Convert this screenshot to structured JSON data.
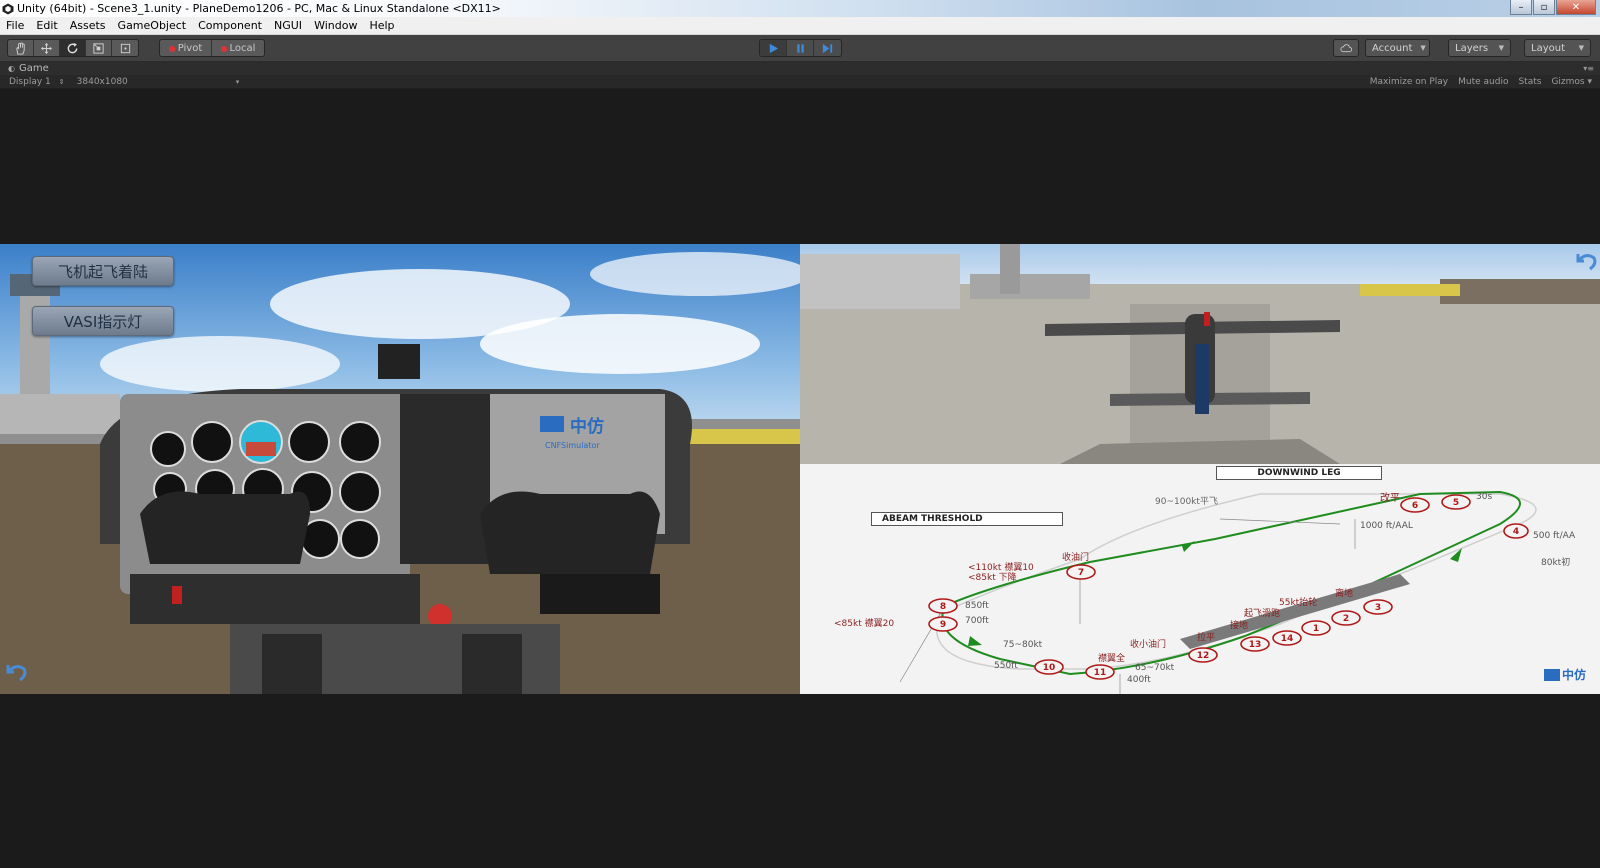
{
  "window": {
    "title": "Unity (64bit) - Scene3_1.unity - PlaneDemo1206 - PC, Mac & Linux Standalone <DX11>",
    "controls": [
      "minimize-icon",
      "maximize-icon",
      "close-icon"
    ]
  },
  "menu": {
    "items": [
      "File",
      "Edit",
      "Assets",
      "GameObject",
      "Component",
      "NGUI",
      "Window",
      "Help"
    ]
  },
  "toolbar": {
    "tools": [
      "hand-icon",
      "move-icon",
      "rotate-icon",
      "scale-icon",
      "rect-icon"
    ],
    "pivot_label": "Pivot",
    "local_label": "Local",
    "play": [
      "play-icon",
      "pause-icon",
      "step-icon"
    ],
    "account_label": "Account",
    "layers_label": "Layers",
    "layout_label": "Layout"
  },
  "game_tab": {
    "label": "Game",
    "display": "Display 1",
    "resolution": "3840x1080",
    "maximize_on_play": "Maximize on Play",
    "mute_audio": "Mute audio",
    "stats": "Stats",
    "gizmos": "Gizmos"
  },
  "game_ui": {
    "btn_takeoff": "飞机起飞着陆",
    "btn_vasi": "VASI指示灯",
    "panel_brand": "中仿",
    "panel_brand_sub": "CNFSimulator",
    "chart": {
      "downwind": "DOWNWIND LEG",
      "abeam": "ABEAM THRESHOLD",
      "gaiping": "改平",
      "speed_downwind": "90~100kt平飞",
      "alt_1000": "1000 ft/AAL",
      "shouyoumen": "收油门",
      "flap10": "<110kt 襟翼10",
      "xiajiang": "<85kt  下降",
      "flap20": "<85kt 襟翼20",
      "ft850": "850ft",
      "ft700": "700ft",
      "speed_75_80": "75~80kt",
      "ft550": "550ft",
      "shouxiaoyoumen": "收小油门",
      "flapfull": "襟翼全",
      "speed_65_70": "65~70kt",
      "ft400": "400ft",
      "laping": "拉平",
      "jiedi": "接地",
      "qifeihuapao": "起飞滑跑",
      "taichun": "55kt抬轮",
      "lidi": "离地",
      "kt30s": "30s",
      "ft500": "500 ft/AA",
      "kt80": "80kt初",
      "brand": "中仿",
      "points": [
        "1",
        "2",
        "3",
        "4",
        "5",
        "6",
        "7",
        "8",
        "9",
        "10",
        "11",
        "12",
        "13",
        "14"
      ]
    }
  }
}
